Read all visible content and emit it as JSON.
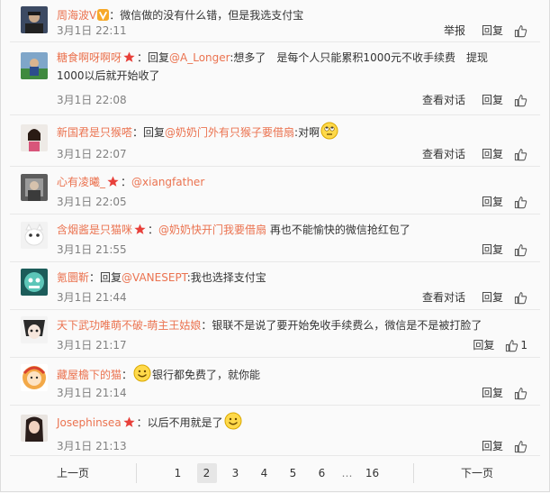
{
  "comments": [
    {
      "nick": "周海波V",
      "vip": true,
      "star": false,
      "segments": [
        {
          "t": "：微信做的没有什么错，但是我选支付宝",
          "c": "text"
        }
      ],
      "time": "3月1日 22:11",
      "actions": [
        "举报",
        "回复"
      ],
      "likes": ""
    },
    {
      "nick": "糖食啊呀啊呀",
      "vip": false,
      "star": true,
      "segments": [
        {
          "t": "：回复",
          "c": "text"
        },
        {
          "t": "@A_Longer",
          "c": "mention"
        },
        {
          "t": ":想多了　是每个人只能累积1000元不收手续费　提现1000以后就开始收了",
          "c": "text"
        }
      ],
      "time": "3月1日 22:08",
      "actions": [
        "查看对话",
        "回复"
      ],
      "likes": ""
    },
    {
      "nick": "新国君是只猴嗒",
      "vip": false,
      "star": false,
      "segments": [
        {
          "t": "：回复",
          "c": "text"
        },
        {
          "t": "@奶奶门外有只猴子要借扇",
          "c": "mention"
        },
        {
          "t": ":对啊",
          "c": "text"
        }
      ],
      "emoji": "roll-eyes-emoji",
      "time": "3月1日 22:07",
      "actions": [
        "查看对话",
        "回复"
      ],
      "likes": ""
    },
    {
      "nick": "心有凌曦_",
      "vip": false,
      "star": true,
      "segments": [
        {
          "t": "：",
          "c": "text"
        },
        {
          "t": "@xiangfather",
          "c": "mention"
        }
      ],
      "time": "3月1日 22:05",
      "actions": [
        "回复"
      ],
      "likes": ""
    },
    {
      "nick": "含烟酱是只猫咪",
      "vip": false,
      "star": true,
      "segments": [
        {
          "t": "：",
          "c": "text"
        },
        {
          "t": "@奶奶快开门我要借扇",
          "c": "mention"
        },
        {
          "t": " 再也不能愉快的微信抢红包了",
          "c": "text"
        }
      ],
      "time": "3月1日 21:55",
      "actions": [
        "回复"
      ],
      "likes": ""
    },
    {
      "nick": "氪圜靳",
      "vip": false,
      "star": false,
      "segments": [
        {
          "t": "：回复",
          "c": "text"
        },
        {
          "t": "@VANESEPT",
          "c": "mention"
        },
        {
          "t": ":我也选择支付宝",
          "c": "text"
        }
      ],
      "time": "3月1日 21:44",
      "actions": [
        "查看对话",
        "回复"
      ],
      "likes": ""
    },
    {
      "nick": "天下武功唯萌不破-萌主王姑娘",
      "vip": false,
      "star": false,
      "segments": [
        {
          "t": "：银联不是说了要开始免收手续费么，微信是不是被打脸了",
          "c": "text"
        }
      ],
      "time": "3月1日 21:17",
      "actions": [
        "回复"
      ],
      "likes": "1"
    },
    {
      "nick": "藏屋檐下的猫",
      "vip": false,
      "star": false,
      "segments": [
        {
          "t": "：",
          "c": "text"
        }
      ],
      "emoji_mid": "smile-emoji",
      "segments2": [
        {
          "t": "银行都免费了，就你能",
          "c": "text"
        }
      ],
      "time": "3月1日 21:14",
      "actions": [
        "回复"
      ],
      "likes": ""
    },
    {
      "nick": "Josephinsea",
      "vip": false,
      "star": true,
      "segments": [
        {
          "t": "：以后不用就是了",
          "c": "text"
        }
      ],
      "emoji": "smile-emoji",
      "time": "3月1日 21:13",
      "actions": [
        "回复"
      ],
      "likes": ""
    }
  ],
  "pager": {
    "prev": "上一页",
    "next": "下一页",
    "pages": [
      "1",
      "2",
      "3",
      "4",
      "5",
      "6",
      "…",
      "16"
    ],
    "current": "2"
  },
  "colors": {
    "nick": "#eb7350",
    "text": "#333333",
    "time": "#808080",
    "star": "#e8403a",
    "vip": "#f7a929"
  }
}
